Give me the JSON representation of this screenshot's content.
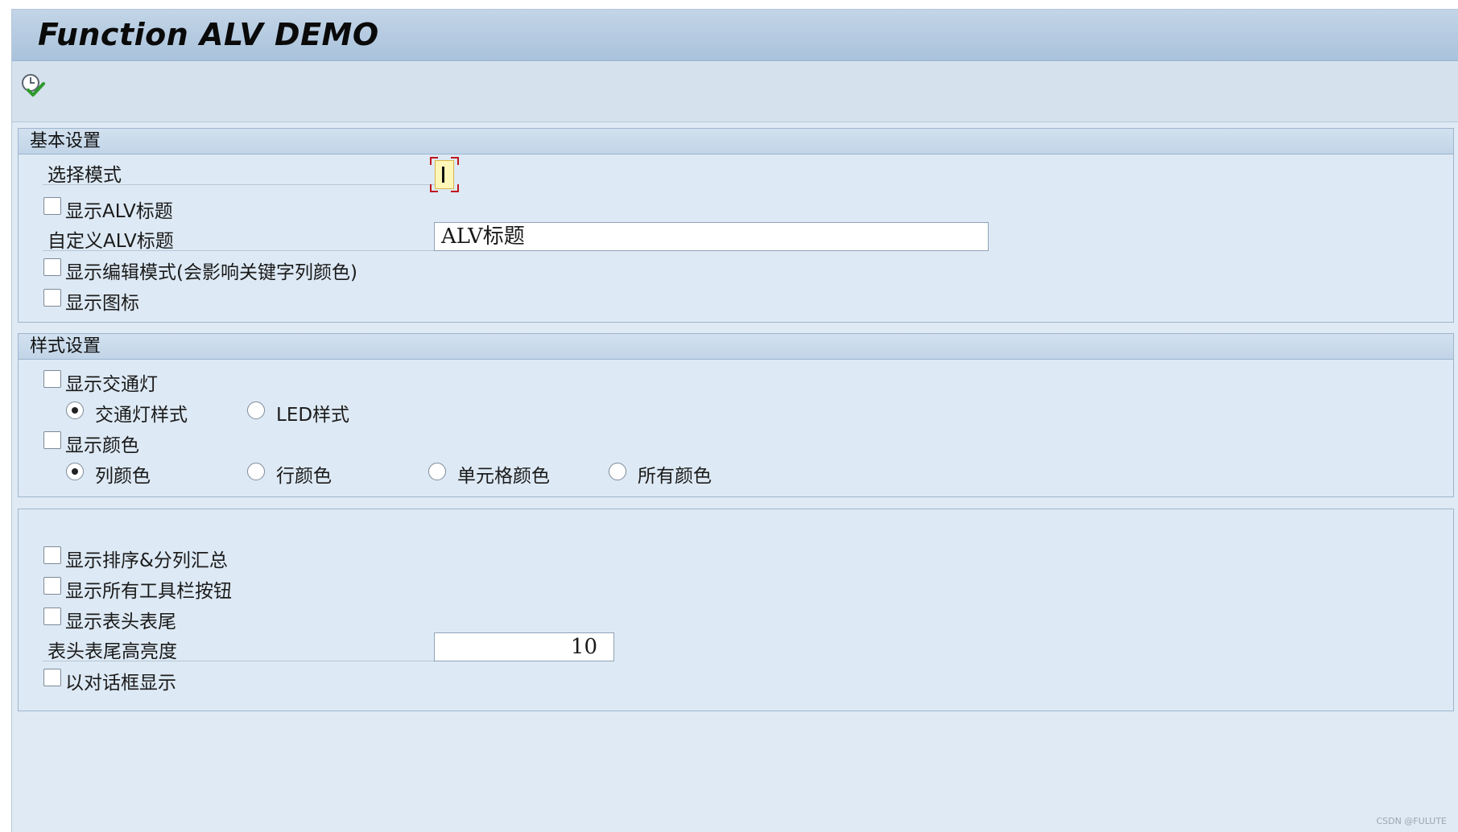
{
  "window": {
    "title": "Function ALV DEMO"
  },
  "toolbar": {
    "execute_icon": "execute-icon"
  },
  "basic": {
    "header": "基本设置",
    "select_mode_label": "选择模式",
    "select_mode_value": "",
    "show_alv_title_label": "显示ALV标题",
    "custom_alv_title_label": "自定义ALV标题",
    "custom_alv_title_value": "ALV标题",
    "show_edit_mode_label": "显示编辑模式(会影响关键字列颜色)",
    "show_icon_label": "显示图标"
  },
  "style": {
    "header": "样式设置",
    "show_traffic_label": "显示交通灯",
    "traffic_style_label": "交通灯样式",
    "led_style_label": "LED样式",
    "show_color_label": "显示颜色",
    "column_color_label": "列颜色",
    "row_color_label": "行颜色",
    "cell_color_label": "单元格颜色",
    "all_color_label": "所有颜色"
  },
  "other": {
    "show_sort_label": "显示排序&分列汇总",
    "show_toolbar_label": "显示所有工具栏按钮",
    "show_header_footer_label": "显示表头表尾",
    "header_footer_height_label": "表头表尾高亮度",
    "header_footer_height_value": "10",
    "dialog_label": "以对话框显示"
  },
  "footer": {
    "watermark": "CSDN @FULUTE"
  },
  "colors": {
    "titlebar": "#b4cade",
    "background": "#dfeaf4",
    "group_border": "#9fb6cf",
    "focus_corner": "#c0141c"
  }
}
